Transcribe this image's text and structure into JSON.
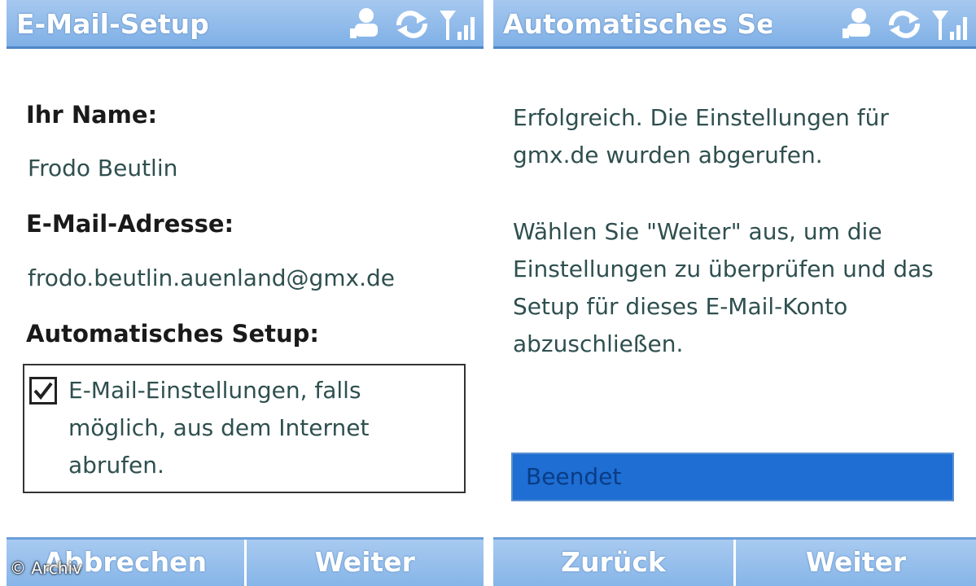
{
  "left": {
    "title": "E-Mail-Setup",
    "name_label": "Ihr Name:",
    "name_value": "Frodo Beutlin",
    "email_label": "E-Mail-Adresse:",
    "email_value": "frodo.beutlin.auenland@gmx.de",
    "auto_setup_label": "Automatisches Setup:",
    "checkbox_checked": true,
    "checkbox_text": "E-Mail-Einstellungen, falls möglich, aus dem Internet abrufen.",
    "softkeys": [
      "Abbrechen",
      "Weiter"
    ]
  },
  "right": {
    "title": "Automatisches Se",
    "message_1": "Erfolgreich. Die Einstellungen für gmx.de wurden abgerufen.",
    "message_2": "Wählen Sie \"Weiter\" aus, um die Einstellungen zu überprüfen und das Setup für dieses E-Mail-Konto abzuschließen.",
    "progress_label": "Beendet",
    "progress_value": 1.0,
    "softkeys": [
      "Zurück",
      "Weiter"
    ]
  },
  "status_icons": [
    "network-user-icon",
    "sync-icon",
    "signal-strength-icon"
  ],
  "colors": {
    "titlebar": "#86b5e8",
    "progress": "#1e6ed3",
    "text": "#2f4f4f"
  },
  "watermark": "© Archiv"
}
